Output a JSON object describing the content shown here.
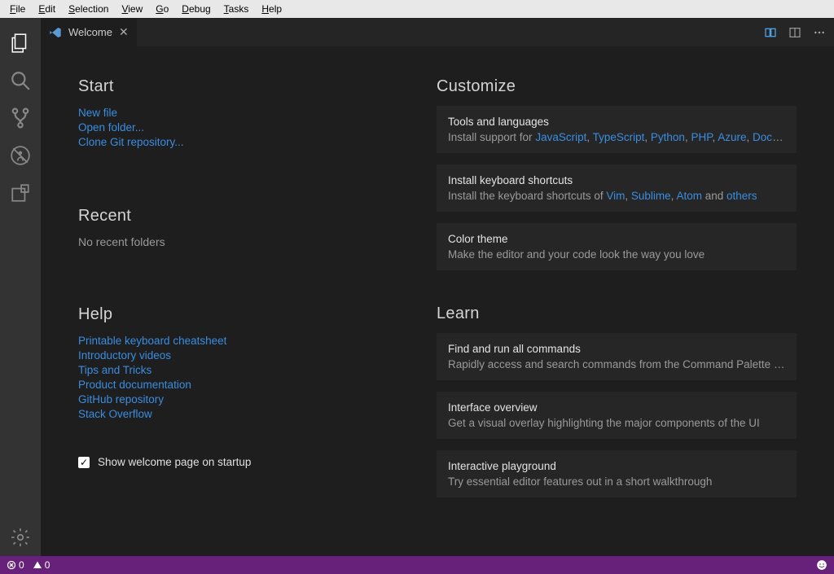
{
  "menubar": [
    "File",
    "Edit",
    "Selection",
    "View",
    "Go",
    "Debug",
    "Tasks",
    "Help"
  ],
  "tab": {
    "title": "Welcome"
  },
  "start": {
    "heading": "Start",
    "links": [
      "New file",
      "Open folder...",
      "Clone Git repository..."
    ]
  },
  "recent": {
    "heading": "Recent",
    "empty": "No recent folders"
  },
  "help": {
    "heading": "Help",
    "links": [
      "Printable keyboard cheatsheet",
      "Introductory videos",
      "Tips and Tricks",
      "Product documentation",
      "GitHub repository",
      "Stack Overflow"
    ]
  },
  "welcome_checkbox": "Show welcome page on startup",
  "customize": {
    "heading": "Customize",
    "tools": {
      "title": "Tools and languages",
      "prefix": "Install support for ",
      "links": [
        "JavaScript",
        "TypeScript",
        "Python",
        "PHP",
        "Azure",
        "Dock…"
      ]
    },
    "shortcuts": {
      "title": "Install keyboard shortcuts",
      "prefix": "Install the keyboard shortcuts of ",
      "links": [
        "Vim",
        "Sublime",
        "Atom"
      ],
      "and": " and ",
      "last": "others"
    },
    "theme": {
      "title": "Color theme",
      "sub": "Make the editor and your code look the way you love"
    }
  },
  "learn": {
    "heading": "Learn",
    "cmds": {
      "title": "Find and run all commands",
      "sub": "Rapidly access and search commands from the Command Palette (C…"
    },
    "overview": {
      "title": "Interface overview",
      "sub": "Get a visual overlay highlighting the major components of the UI"
    },
    "playground": {
      "title": "Interactive playground",
      "sub": "Try essential editor features out in a short walkthrough"
    }
  },
  "status": {
    "errors": "0",
    "warnings": "0"
  }
}
